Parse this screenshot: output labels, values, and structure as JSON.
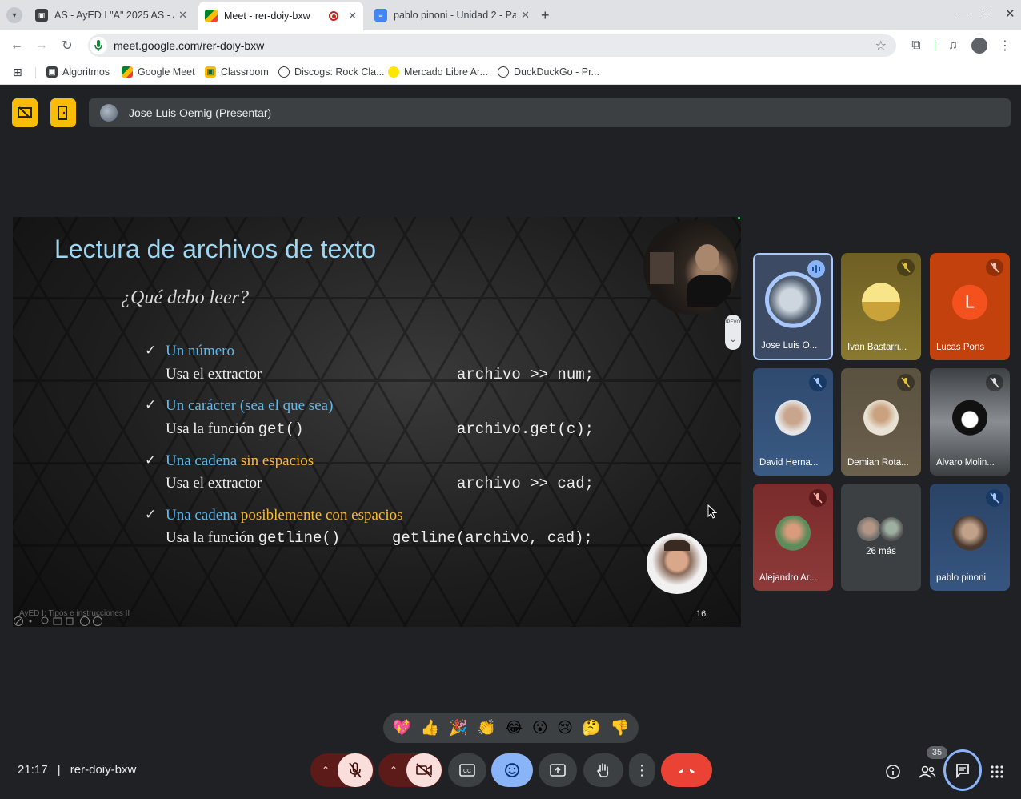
{
  "browser": {
    "tabs": [
      {
        "title": "AS - AyED I \"A\" 2025 AS - Al",
        "active": false
      },
      {
        "title": "Meet - rer-doiy-bxw",
        "active": true
      },
      {
        "title": "pablo pinoni - Unidad 2 - Pa",
        "active": false
      }
    ],
    "url": "meet.google.com/rer-doiy-bxw",
    "bookmarks": [
      "Algoritmos",
      "Google Meet",
      "Classroom",
      "Discogs: Rock Cla...",
      "Mercado Libre Ar...",
      "DuckDuckGo - Pr..."
    ]
  },
  "meet": {
    "presenter_label": "Jose Luis Oemig (Presentar)",
    "time": "21:17",
    "separator": "|",
    "meeting_code": "rer-doiy-bxw",
    "participants_count": "35",
    "reactions": [
      "💖",
      "👍",
      "🎉",
      "👏",
      "😂",
      "😮",
      "😢",
      "🤔",
      "👎"
    ]
  },
  "slide": {
    "title": "Lectura de archivos de texto",
    "subtitle": "¿Qué debo leer?",
    "items": [
      {
        "head_a": "Un número",
        "head_b": "",
        "desc": "Usa el extractor",
        "desc_code": "",
        "code": "archivo >> num;"
      },
      {
        "head_a": "Un carácter (sea el que sea)",
        "head_b": "",
        "desc": "Usa la función ",
        "desc_code": "get()",
        "code": "archivo.get(c);"
      },
      {
        "head_a": "Una cadena ",
        "head_b": "sin espacios",
        "desc": "Usa el extractor",
        "desc_code": "",
        "code": "archivo >> cad;"
      },
      {
        "head_a": "Una cadena ",
        "head_b": "posiblemente con espacios",
        "desc": "Usa la función ",
        "desc_code": "getline()",
        "code": "getline(archivo, cad);"
      }
    ],
    "footer": "AyED I: Tipos e instrucciones II",
    "page": "16",
    "side_label": "IPEVO"
  },
  "tiles": [
    {
      "name": "Jose Luis O...",
      "speaking": true,
      "bg": "#3c4a63"
    },
    {
      "name": "Ivan Bastarri...",
      "speaking": false,
      "bg": "#7a6a2a"
    },
    {
      "name": "Lucas Pons",
      "speaking": false,
      "bg": "#c2410c",
      "initial": "L"
    },
    {
      "name": "David Herna...",
      "speaking": false,
      "bg": "#2f4a6e"
    },
    {
      "name": "Demian Rota...",
      "speaking": false,
      "bg": "#5b5140"
    },
    {
      "name": "Alvaro Molin...",
      "speaking": false,
      "bg": "#5f6368"
    },
    {
      "name": "Alejandro Ar...",
      "speaking": false,
      "bg": "#7a2b2b"
    },
    {
      "name": "26 más",
      "speaking": false,
      "bg": "#3c4043"
    },
    {
      "name": "pablo pinoni",
      "speaking": false,
      "bg": "#2a4366"
    }
  ],
  "colors": {
    "accent_yellow": "#fbbc04",
    "end_call": "#ea4335",
    "mic_off": "#f9dedc",
    "active_btn": "#8ab4f8"
  }
}
